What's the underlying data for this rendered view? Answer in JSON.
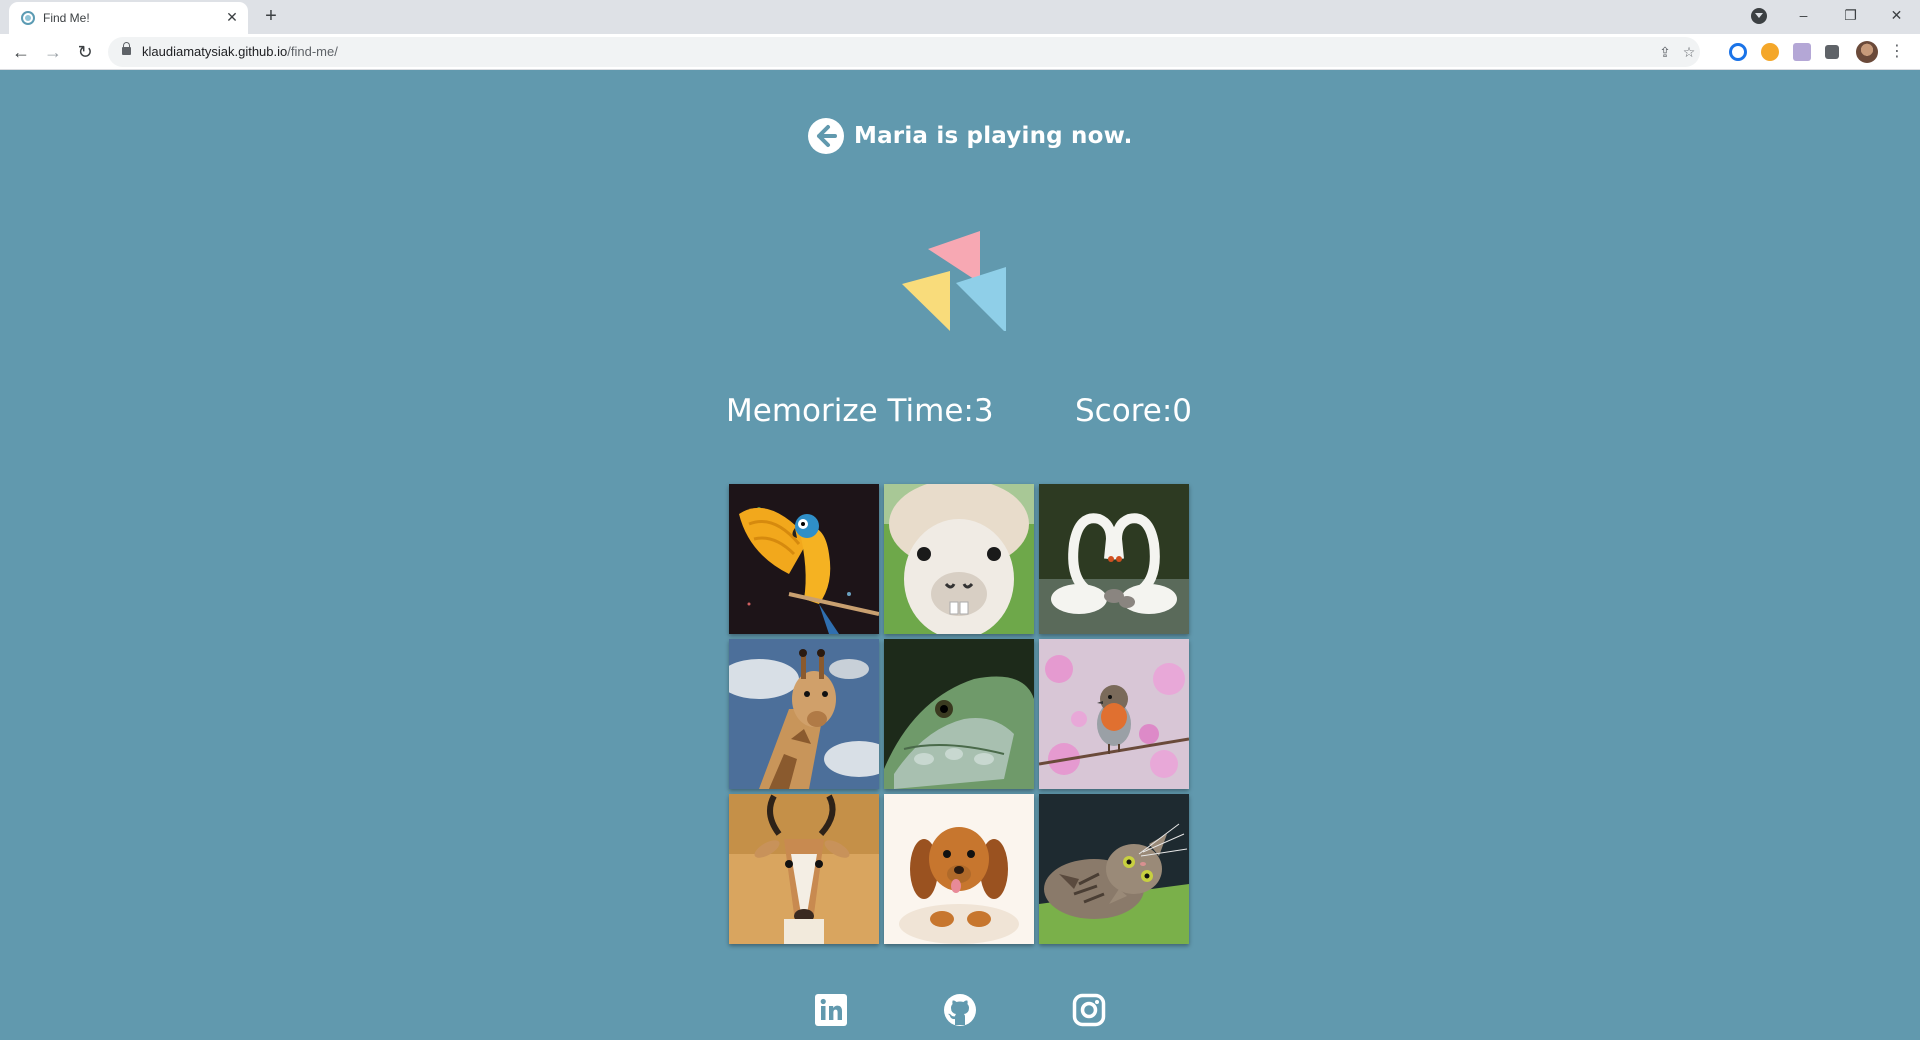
{
  "browser": {
    "tab_title": "Find Me!",
    "tab_close": "✕",
    "new_tab": "+",
    "url_host": "klaudiamatysiak.github.io",
    "url_path": "/find-me/",
    "window_minimize": "–",
    "window_restore": "❐",
    "window_close": "✕"
  },
  "header": {
    "text": "Maria is playing now."
  },
  "stats": {
    "memorize_time": "Memorize Time:3",
    "score": "Score:0"
  },
  "cards": [
    {
      "icon": "parrot-image"
    },
    {
      "icon": "alpaca-image"
    },
    {
      "icon": "swans-image"
    },
    {
      "icon": "giraffe-image"
    },
    {
      "icon": "iguana-image"
    },
    {
      "icon": "robin-image"
    },
    {
      "icon": "gazelle-image"
    },
    {
      "icon": "puppy-image"
    },
    {
      "icon": "cat-image"
    }
  ],
  "socials": [
    {
      "icon": "linkedin-icon"
    },
    {
      "icon": "github-icon"
    },
    {
      "icon": "instagram-icon"
    }
  ],
  "colors": {
    "background": "#6199ae",
    "logo_pink": "#f7a8b3",
    "logo_yellow": "#f9dc7b",
    "logo_blue": "#8fcfe8"
  }
}
